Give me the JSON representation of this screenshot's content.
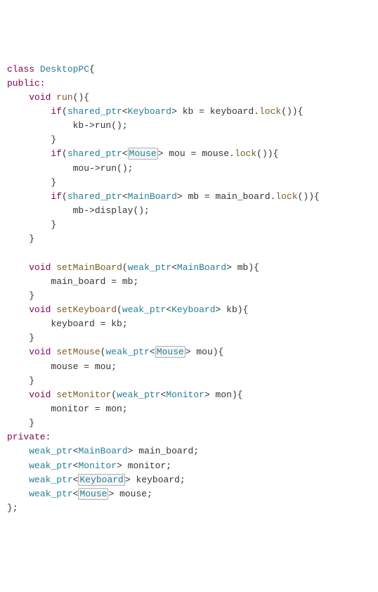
{
  "class_decl": {
    "kw_class": "class",
    "name": "DesktopPC",
    "brace": "{"
  },
  "public_label": "public:",
  "run": {
    "sig_void": "void",
    "sig_name": "run",
    "sig_rest": "(){",
    "if1": {
      "kw": "if",
      "open": "(",
      "sp": "shared_ptr",
      "lt": "<",
      "t": "Keyboard",
      "gt": ">",
      "var": " kb ",
      "eq": "=",
      "obj": " keyboard",
      "dot": ".",
      "lock": "lock",
      "rest": "()){"
    },
    "if1_body": "kb->run();",
    "if1_close": "}",
    "if2": {
      "kw": "if",
      "open": "(",
      "sp": "shared_ptr",
      "lt": "<",
      "t": "Mouse",
      "gt": ">",
      "var": " mou ",
      "eq": "=",
      "obj": " mouse",
      "dot": ".",
      "lock": "lock",
      "rest": "()){"
    },
    "if2_body": "mou->run();",
    "if2_close": "}",
    "if3": {
      "kw": "if",
      "open": "(",
      "sp": "shared_ptr",
      "lt": "<",
      "t": "MainBoard",
      "gt": ">",
      "var": " mb ",
      "eq": "=",
      "obj": " main_board",
      "dot": ".",
      "lock": "lock",
      "rest": "()){"
    },
    "if3_body": "mb->display();",
    "if3_close": "}",
    "close": "}"
  },
  "setMainBoard": {
    "void": "void",
    "name": "setMainBoard",
    "open": "(",
    "wp": "weak_ptr",
    "lt": "<",
    "t": "MainBoard",
    "gt": ">",
    "param": " mb){",
    "body": "main_board = mb;",
    "close": "}"
  },
  "setKeyboard": {
    "void": "void",
    "name": "setKeyboard",
    "open": "(",
    "wp": "weak_ptr",
    "lt": "<",
    "t": "Keyboard",
    "gt": ">",
    "param": " kb){",
    "body": "keyboard = kb;",
    "close": "}"
  },
  "setMouse": {
    "void": "void",
    "name": "setMouse",
    "open": "(",
    "wp": "weak_ptr",
    "lt": "<",
    "t": "Mouse",
    "gt": ">",
    "param": " mou){",
    "body": "mouse = mou;",
    "close": "}"
  },
  "setMonitor": {
    "void": "void",
    "name": "setMonitor",
    "open": "(",
    "wp": "weak_ptr",
    "lt": "<",
    "t": "Monitor",
    "gt": ">",
    "param": " mon){",
    "body": "monitor = mon;",
    "close": "}"
  },
  "private_label": "private:",
  "members": {
    "m1": {
      "wp": "weak_ptr",
      "lt": "<",
      "t": "MainBoard",
      "gt": ">",
      "rest": " main_board;"
    },
    "m2": {
      "wp": "weak_ptr",
      "lt": "<",
      "t": "Monitor",
      "gt": ">",
      "rest": " monitor;"
    },
    "m3": {
      "wp": "weak_ptr",
      "lt": "<",
      "t": "Keyboard",
      "gt": ">",
      "rest": " keyboard;"
    },
    "m4": {
      "wp": "weak_ptr",
      "lt": "<",
      "t": "Mouse",
      "gt": ">",
      "rest": " mouse;"
    }
  },
  "end": "};"
}
